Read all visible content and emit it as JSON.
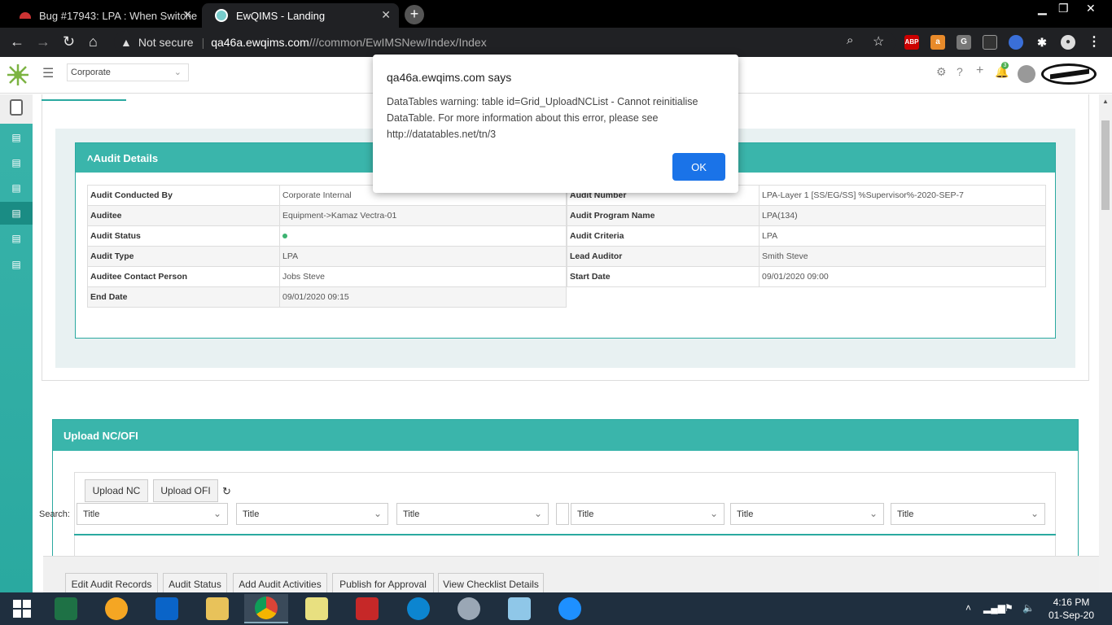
{
  "browser": {
    "tabs": [
      {
        "title": "Bug #17943: LPA : When Switche",
        "active": false
      },
      {
        "title": "EwQIMS - Landing",
        "active": true
      }
    ],
    "not_secure_label": "Not secure",
    "url_host": "qa46a.ewqims.com",
    "url_path": "///common/EwIMSNew/Index/Index"
  },
  "header": {
    "corporate_select": "Corporate",
    "notification_count": "3"
  },
  "audit_details": {
    "title": "Audit Details",
    "left_rows": [
      {
        "label": "Audit Conducted By",
        "value": "Corporate Internal"
      },
      {
        "label": "Auditee",
        "value": "Equipment->Kamaz Vectra-01"
      },
      {
        "label": "Audit Status",
        "value": ""
      },
      {
        "label": "Audit Type",
        "value": "LPA"
      },
      {
        "label": "Auditee Contact Person",
        "value": "Jobs Steve"
      },
      {
        "label": "End Date",
        "value": "09/01/2020 09:15"
      }
    ],
    "right_rows": [
      {
        "label": "Audit Number",
        "value": "LPA-Layer 1 [SS/EG/SS] %Supervisor%-2020-SEP-7"
      },
      {
        "label": "Audit Program Name",
        "value": "LPA(134)"
      },
      {
        "label": "Audit Criteria",
        "value": "LPA"
      },
      {
        "label": "Lead Auditor",
        "value": "Smith Steve"
      },
      {
        "label": "Start Date",
        "value": "09/01/2020 09:00"
      }
    ]
  },
  "upload": {
    "title": "Upload NC/OFI",
    "upload_nc": "Upload NC",
    "upload_ofi": "Upload OFI",
    "search_label": "Search:",
    "filters": [
      "Title",
      "Title",
      "Title",
      "Title",
      "Title",
      "Title"
    ]
  },
  "footer_buttons": [
    "Edit Audit Records",
    "Audit Status",
    "Add Audit Activities",
    "Publish for Approval",
    "View Checklist Details"
  ],
  "dialog": {
    "title": "qa46a.ewqims.com says",
    "message": "DataTables warning: table id=Grid_UploadNCList - Cannot reinitialise DataTable. For more information about this error, please see http://datatables.net/tn/3",
    "ok": "OK"
  },
  "taskbar": {
    "time": "4:16 PM",
    "date": "01-Sep-20"
  }
}
